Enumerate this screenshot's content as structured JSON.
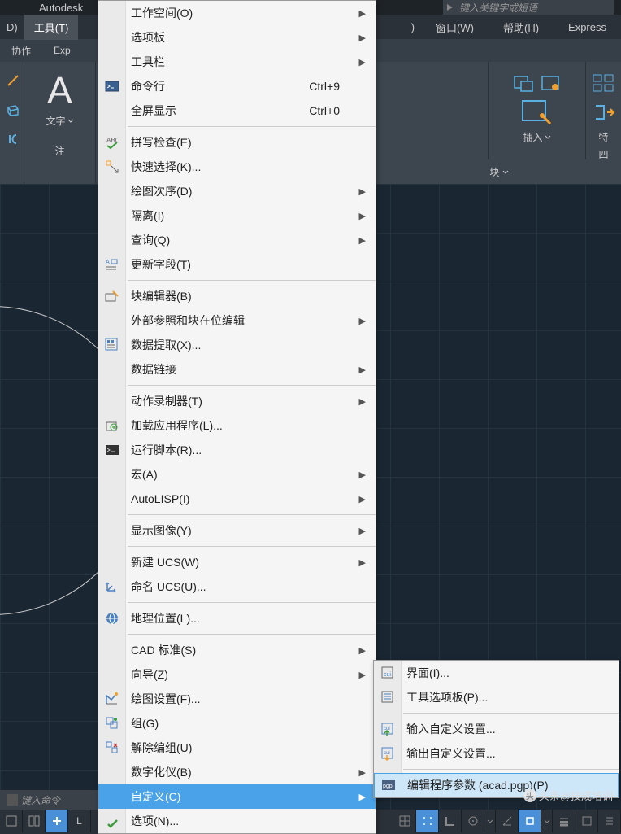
{
  "app": {
    "title": "Autodesk"
  },
  "search": {
    "placeholder": "键入关键字或短语"
  },
  "menubar": {
    "left_item": "D)",
    "tools": "工具(T)",
    "window": "窗口(W)",
    "help": "帮助(H)",
    "express": "Express"
  },
  "tabs": {
    "xiezuo": "协作",
    "exp": "Exp"
  },
  "ribbon": {
    "text_label": "文字",
    "zhu": "注",
    "insert": "插入",
    "te": "特",
    "si": "四",
    "block": "块"
  },
  "cmdline": {
    "prompt": "键入命令"
  },
  "menu": {
    "items": [
      {
        "label": "工作空间(O)",
        "arrow": true
      },
      {
        "label": "选项板",
        "arrow": true
      },
      {
        "label": "工具栏",
        "arrow": true
      },
      {
        "label": "命令行",
        "shortcut": "Ctrl+9",
        "icon": "cmdline"
      },
      {
        "label": "全屏显示",
        "shortcut": "Ctrl+0"
      },
      {
        "sep": true
      },
      {
        "label": "拼写检查(E)",
        "icon": "abc"
      },
      {
        "label": "快速选择(K)...",
        "icon": "qselect"
      },
      {
        "label": "绘图次序(D)",
        "arrow": true
      },
      {
        "label": "隔离(I)",
        "arrow": true
      },
      {
        "label": "查询(Q)",
        "arrow": true
      },
      {
        "label": "更新字段(T)",
        "icon": "field"
      },
      {
        "sep": true
      },
      {
        "label": "块编辑器(B)",
        "icon": "bedit"
      },
      {
        "label": "外部参照和块在位编辑",
        "arrow": true
      },
      {
        "label": "数据提取(X)...",
        "icon": "dextract"
      },
      {
        "label": "数据链接",
        "arrow": true
      },
      {
        "sep": true
      },
      {
        "label": "动作录制器(T)",
        "arrow": true
      },
      {
        "label": "加载应用程序(L)...",
        "icon": "appload"
      },
      {
        "label": "运行脚本(R)...",
        "icon": "script"
      },
      {
        "label": "宏(A)",
        "arrow": true
      },
      {
        "label": "AutoLISP(I)",
        "arrow": true
      },
      {
        "sep": true
      },
      {
        "label": "显示图像(Y)",
        "arrow": true
      },
      {
        "sep": true
      },
      {
        "label": "新建 UCS(W)",
        "arrow": true
      },
      {
        "label": "命名 UCS(U)...",
        "icon": "ucs"
      },
      {
        "sep": true
      },
      {
        "label": "地理位置(L)...",
        "icon": "geo"
      },
      {
        "sep": true
      },
      {
        "label": "CAD 标准(S)",
        "arrow": true
      },
      {
        "label": "向导(Z)",
        "arrow": true
      },
      {
        "label": "绘图设置(F)...",
        "icon": "dsettings"
      },
      {
        "label": "组(G)",
        "icon": "group"
      },
      {
        "label": "解除编组(U)",
        "icon": "ungroup"
      },
      {
        "label": "数字化仪(B)",
        "arrow": true
      },
      {
        "label": "自定义(C)",
        "arrow": true,
        "highlight": true
      },
      {
        "label": "选项(N)...",
        "icon": "options"
      }
    ]
  },
  "submenu": {
    "items": [
      {
        "label": "界面(I)...",
        "icon": "cui"
      },
      {
        "label": "工具选项板(P)...",
        "icon": "toolpal"
      },
      {
        "sep": true
      },
      {
        "label": "输入自定义设置...",
        "icon": "import"
      },
      {
        "label": "输出自定义设置...",
        "icon": "export"
      },
      {
        "sep": true
      },
      {
        "label": "编辑程序参数 (acad.pgp)(P)",
        "icon": "pgp",
        "highlight": true
      }
    ]
  },
  "watermark": {
    "text": "头条@技成培训"
  }
}
